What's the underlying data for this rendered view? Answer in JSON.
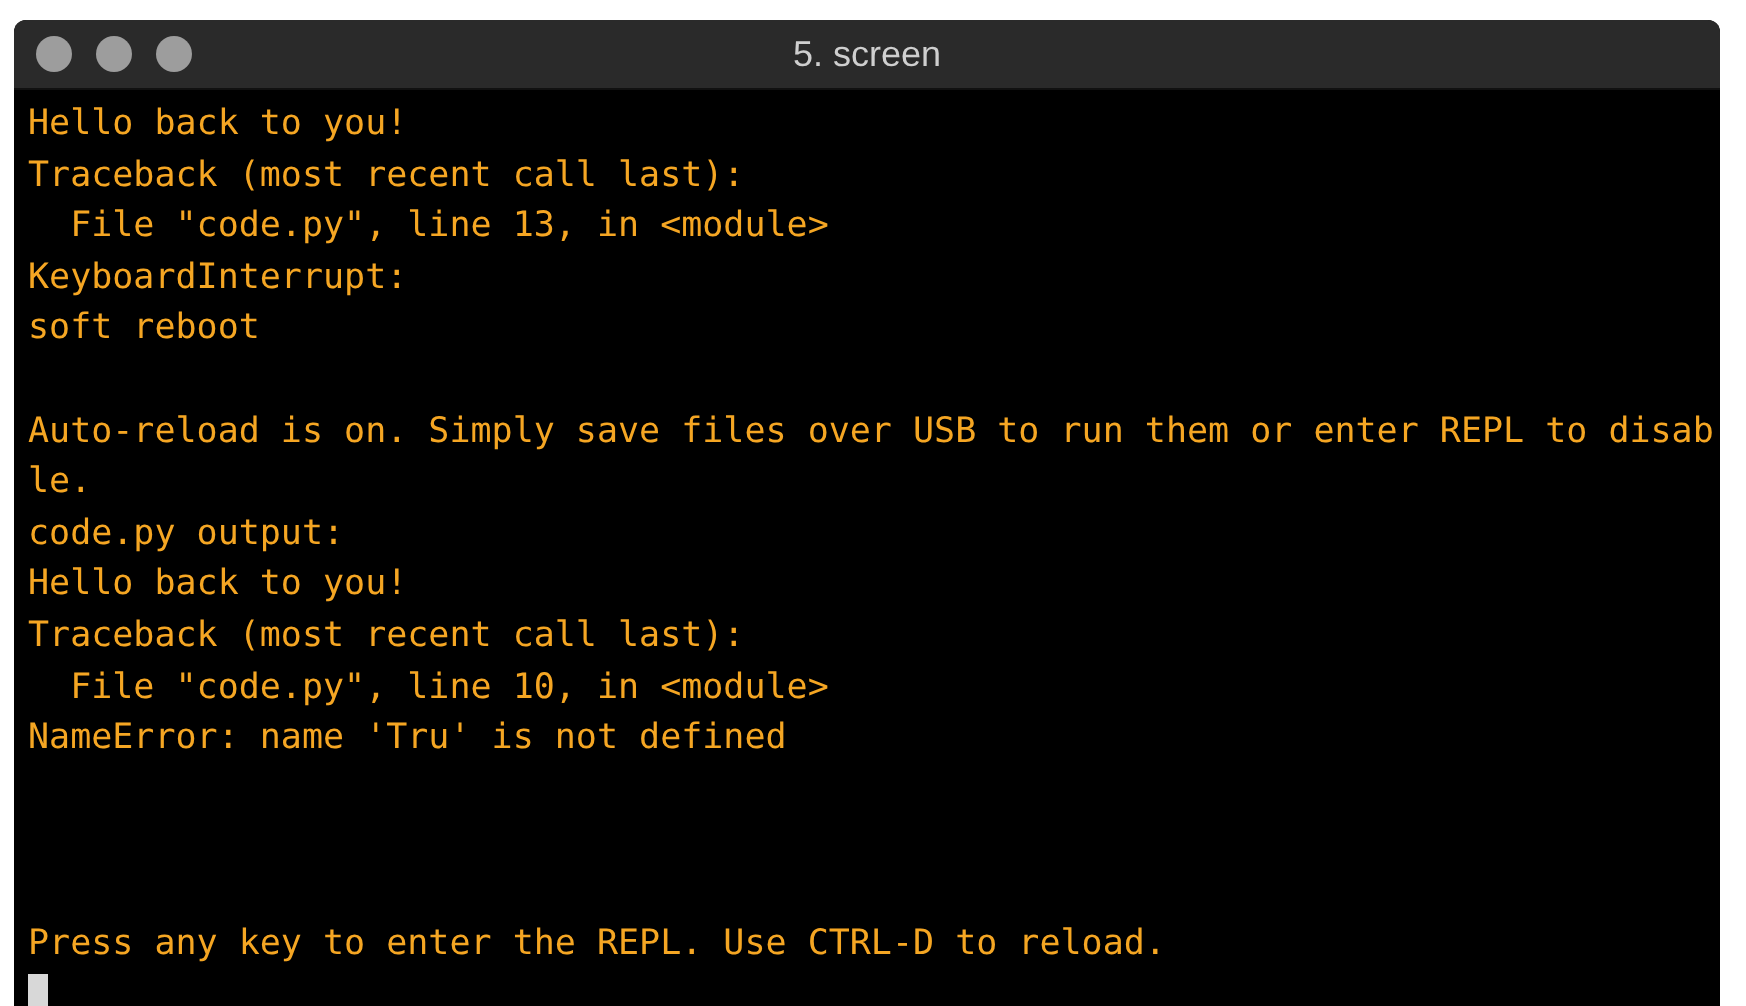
{
  "window": {
    "title": "5. screen"
  },
  "terminal": {
    "lines": [
      {
        "kind": "text",
        "text": "Hello back to you!"
      },
      {
        "kind": "text",
        "text": "Traceback (most recent call last):"
      },
      {
        "kind": "text",
        "text": "  File \"code.py\", line 13, in <module>"
      },
      {
        "kind": "text",
        "text": "KeyboardInterrupt:"
      },
      {
        "kind": "text",
        "text": "soft reboot"
      },
      {
        "kind": "blank"
      },
      {
        "kind": "text",
        "text": "Auto-reload is on. Simply save files over USB to run them or enter REPL to disab"
      },
      {
        "kind": "text",
        "text": "le."
      },
      {
        "kind": "text",
        "text": "code.py output:"
      },
      {
        "kind": "text",
        "text": "Hello back to you!"
      },
      {
        "kind": "text",
        "text": "Traceback (most recent call last):"
      },
      {
        "kind": "text",
        "text": "  File \"code.py\", line 10, in <module>"
      },
      {
        "kind": "text",
        "text": "NameError: name 'Tru' is not defined"
      },
      {
        "kind": "blank"
      },
      {
        "kind": "blank"
      },
      {
        "kind": "blank"
      },
      {
        "kind": "text",
        "text": "Press any key to enter the REPL. Use CTRL-D to reload."
      }
    ],
    "cursor_visible": true
  }
}
